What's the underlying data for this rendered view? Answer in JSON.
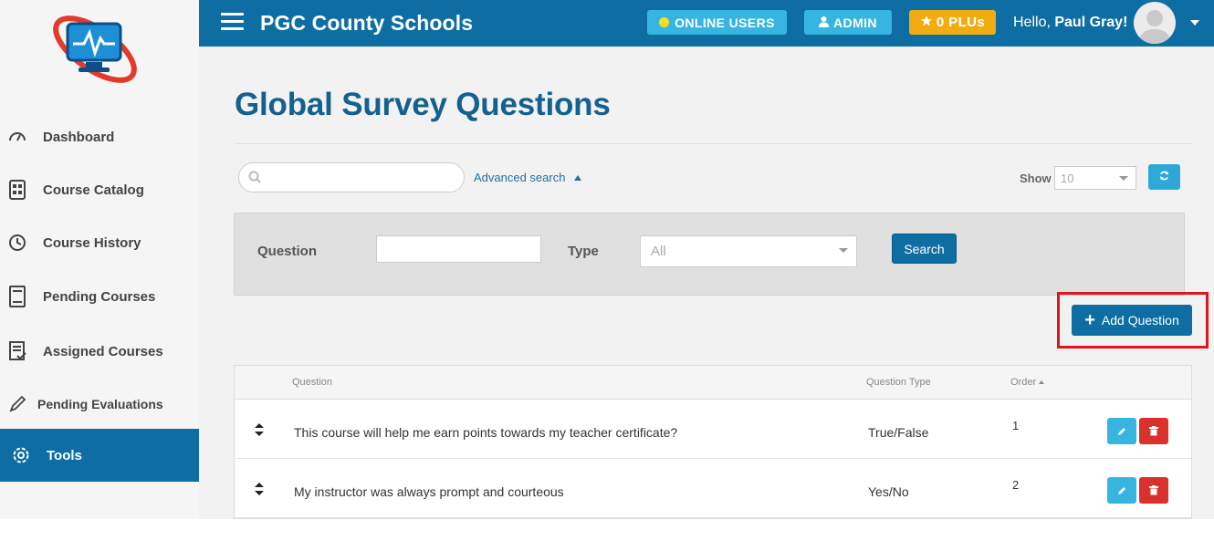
{
  "header": {
    "brand": "PGC County Schools",
    "online_users": "ONLINE USERS",
    "admin": "ADMIN",
    "plus": "0 PLUs",
    "hello_prefix": "Hello,",
    "user_name": "Paul Gray!"
  },
  "sidebar": {
    "items": [
      {
        "label": "Dashboard",
        "icon": "gauge-icon"
      },
      {
        "label": "Course Catalog",
        "icon": "catalog-icon"
      },
      {
        "label": "Course History",
        "icon": "history-icon"
      },
      {
        "label": "Pending Courses",
        "icon": "book-icon"
      },
      {
        "label": "Assigned Courses",
        "icon": "clipboard-icon"
      },
      {
        "label": "Pending Evaluations",
        "icon": "pencil-icon"
      },
      {
        "label": "Tools",
        "icon": "gear-icon"
      }
    ],
    "active": "Tools"
  },
  "page": {
    "title": "Global Survey Questions",
    "search_placeholder": "",
    "advanced_search": "Advanced search",
    "show_label": "Show",
    "show_value": "10"
  },
  "filters": {
    "question_label": "Question",
    "question_value": "",
    "type_label": "Type",
    "type_value": "All",
    "search_button": "Search"
  },
  "add_button": "Add Question",
  "table": {
    "columns": [
      "Question",
      "Question Type",
      "Order"
    ],
    "rows": [
      {
        "question": "This course will help me earn points towards my teacher certificate?",
        "type": "True/False",
        "order": "1"
      },
      {
        "question": "My instructor was always prompt and courteous",
        "type": "Yes/No",
        "order": "2"
      }
    ]
  },
  "colors": {
    "primary": "#0e6ea3",
    "info": "#37b5e0",
    "warning": "#f0ad11",
    "danger": "#d9312b",
    "highlight": "#e0141c"
  }
}
